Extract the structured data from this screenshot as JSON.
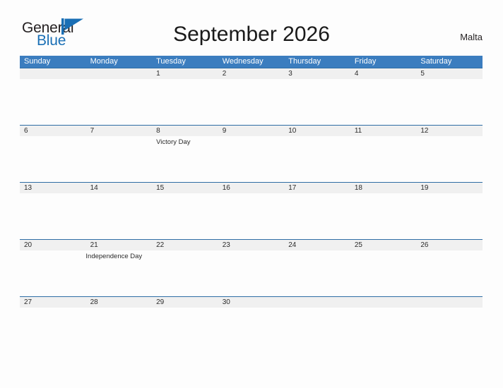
{
  "brand": {
    "name_part1": "General",
    "name_part2": "Blue",
    "flag_icon": "flag-triangle-icon",
    "accent_color": "#1a6fb5"
  },
  "header": {
    "title": "September 2026",
    "country": "Malta"
  },
  "colors": {
    "weekday_header_bg": "#3b7dbf",
    "weekday_header_text": "#ffffff",
    "date_band_bg": "#f0f0f0",
    "band_border": "#2e6da4",
    "page_bg": "#fdfdfd",
    "text": "#2b2b2b"
  },
  "calendar": {
    "month": "September",
    "year": "2026",
    "weekdays": [
      "Sunday",
      "Monday",
      "Tuesday",
      "Wednesday",
      "Thursday",
      "Friday",
      "Saturday"
    ],
    "weeks": [
      {
        "dates": [
          "",
          "",
          "1",
          "2",
          "3",
          "4",
          "5"
        ],
        "events": [
          "",
          "",
          "",
          "",
          "",
          "",
          ""
        ]
      },
      {
        "dates": [
          "6",
          "7",
          "8",
          "9",
          "10",
          "11",
          "12"
        ],
        "events": [
          "",
          "",
          "Victory Day",
          "",
          "",
          "",
          ""
        ]
      },
      {
        "dates": [
          "13",
          "14",
          "15",
          "16",
          "17",
          "18",
          "19"
        ],
        "events": [
          "",
          "",
          "",
          "",
          "",
          "",
          ""
        ]
      },
      {
        "dates": [
          "20",
          "21",
          "22",
          "23",
          "24",
          "25",
          "26"
        ],
        "events": [
          "",
          "Independence Day",
          "",
          "",
          "",
          "",
          ""
        ]
      },
      {
        "dates": [
          "27",
          "28",
          "29",
          "30",
          "",
          "",
          ""
        ],
        "events": [
          "",
          "",
          "",
          "",
          "",
          "",
          ""
        ]
      }
    ]
  }
}
